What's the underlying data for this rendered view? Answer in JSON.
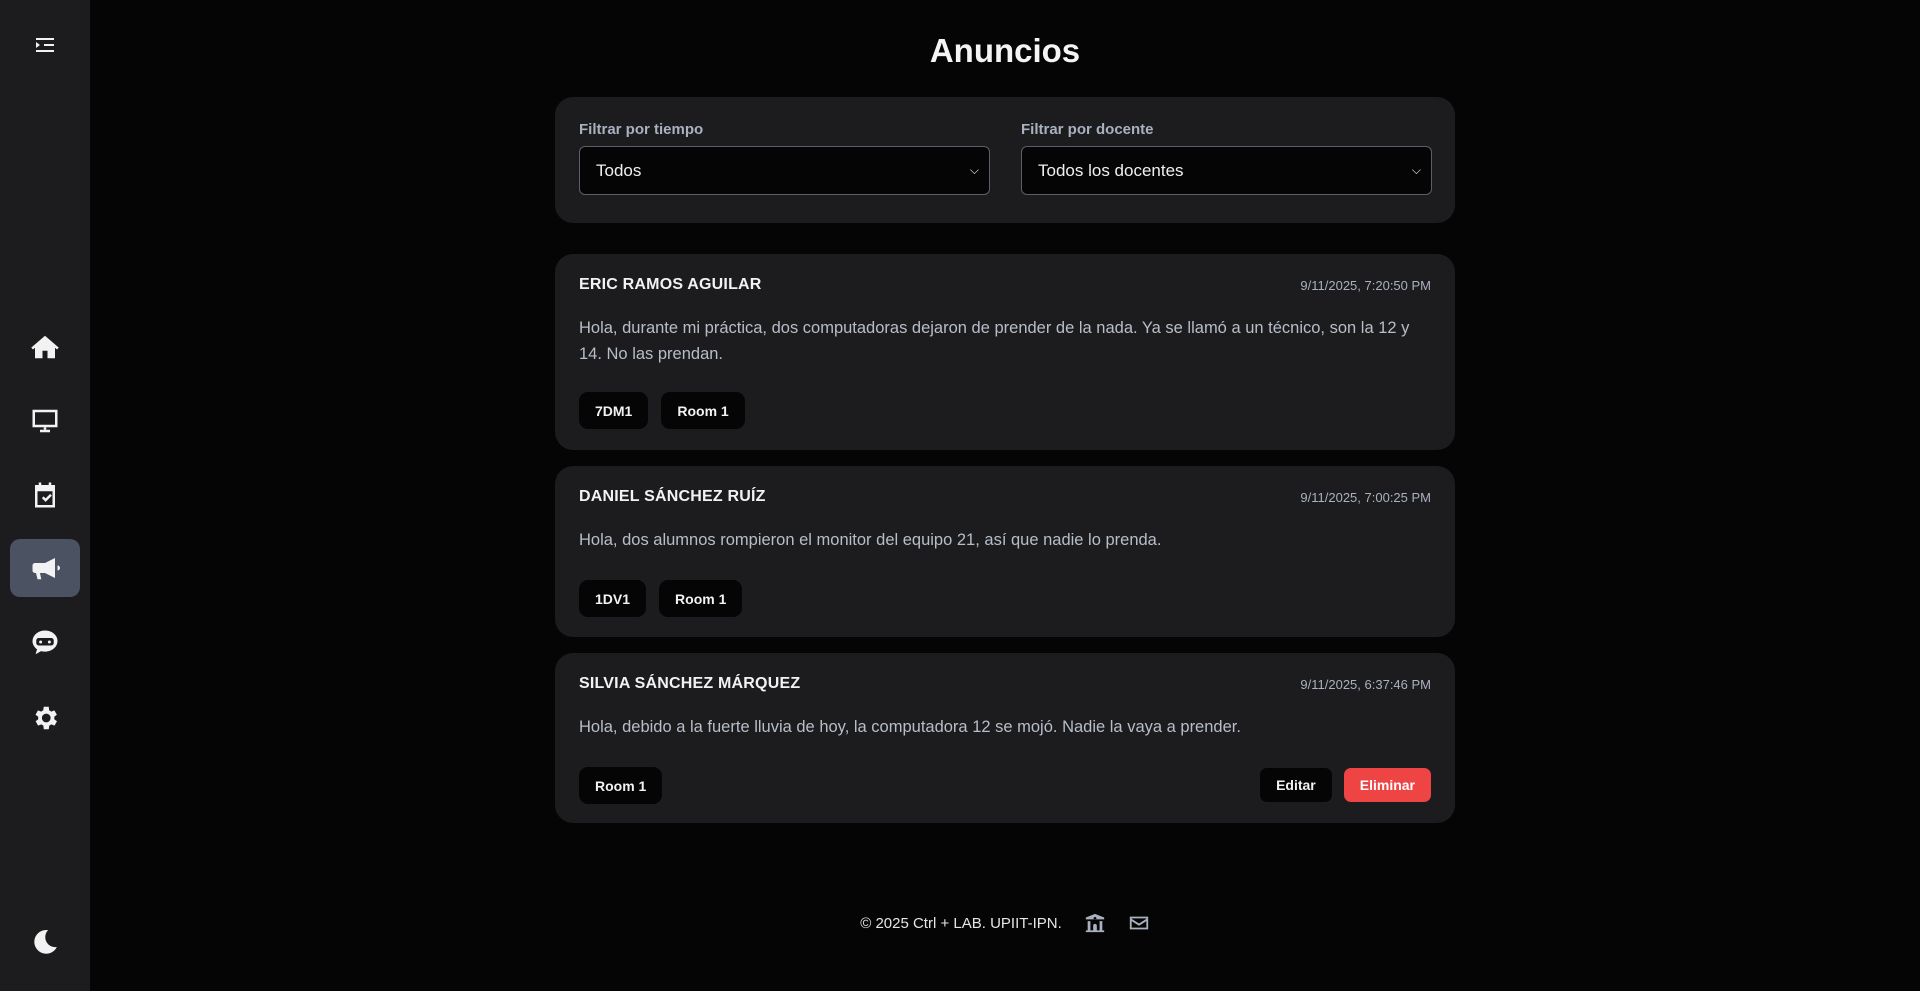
{
  "header": {
    "title": "Anuncios"
  },
  "sidebar": {
    "toggle_icon": "menu-toggle-icon",
    "items": [
      {
        "icon": "home-icon",
        "active": false
      },
      {
        "icon": "monitor-icon",
        "active": false
      },
      {
        "icon": "calendar-check-icon",
        "active": false
      },
      {
        "icon": "megaphone-icon",
        "active": true
      },
      {
        "icon": "chat-bot-icon",
        "active": false
      },
      {
        "icon": "gear-icon",
        "active": false
      }
    ],
    "theme_icon": "moon-icon",
    "active_color": "#4b5363"
  },
  "filters": {
    "time": {
      "label": "Filtrar por tiempo",
      "value": "Todos"
    },
    "teacher": {
      "label": "Filtrar por docente",
      "value": "Todos los docentes"
    }
  },
  "announcements": [
    {
      "author": "ERIC RAMOS AGUILAR",
      "date": "9/11/2025, 7:20:50 PM",
      "message": "Hola, durante mi práctica, dos computadoras dejaron de prender de la nada. Ya se llamó a un técnico, son la 12 y 14. No las prendan.",
      "tags": [
        "7DM1",
        "Room 1"
      ]
    },
    {
      "author": "DANIEL SÁNCHEZ RUÍZ",
      "date": "9/11/2025, 7:00:25 PM",
      "message": "Hola, dos alumnos rompieron el monitor del equipo 21, así que nadie lo prenda.",
      "tags": [
        "1DV1",
        "Room 1"
      ]
    },
    {
      "author": "SILVIA SÁNCHEZ MÁRQUEZ",
      "date": "9/11/2025, 6:37:46 PM",
      "message": "Hola, debido a la fuerte lluvia de hoy, la computadora 12 se mojó. Nadie la vaya a prender.",
      "tags": [
        "Room 1"
      ],
      "actions": {
        "edit": "Editar",
        "delete": "Eliminar"
      }
    }
  ],
  "footer": {
    "text": "© 2025 Ctrl + LAB. UPIIT-IPN.",
    "icons": [
      "school-icon",
      "envelope-icon"
    ]
  },
  "colors": {
    "delete": "#ef4444",
    "panel": "#1c1c1e",
    "background": "#050505"
  }
}
